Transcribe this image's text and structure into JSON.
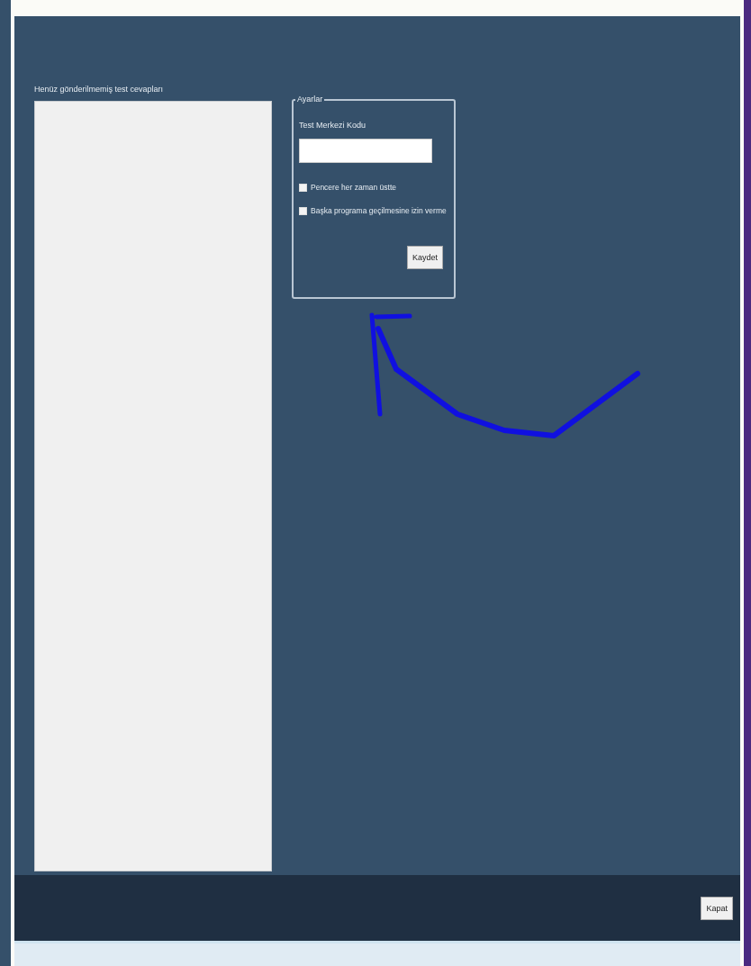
{
  "left_panel": {
    "label": "Henüz gönderilmemiş test cevapları"
  },
  "settings": {
    "legend": "Ayarlar",
    "field_label": "Test Merkezi Kodu",
    "options": [
      {
        "label": "Pencere her zaman üstte",
        "checked": false
      },
      {
        "label": "Başka programa geçilmesine izin verme",
        "checked": false
      }
    ],
    "save_button": "Kaydet"
  },
  "footer": {
    "close_button": "Kapat"
  }
}
